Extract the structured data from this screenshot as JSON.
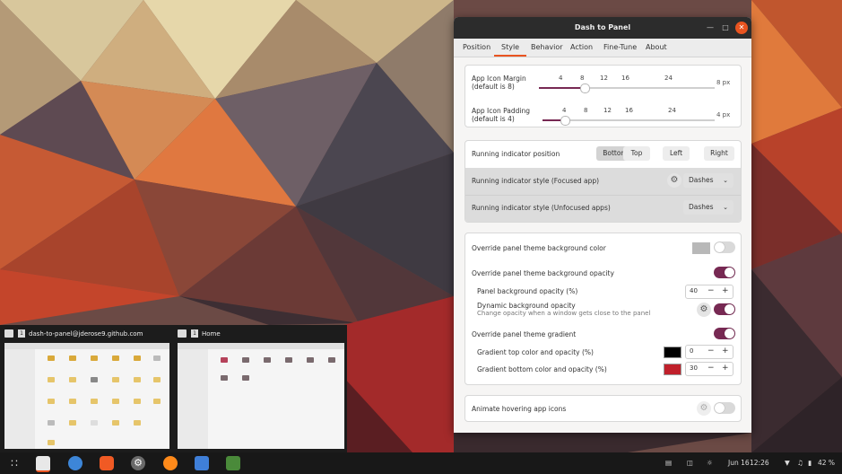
{
  "dialog": {
    "title": "Dash to Panel",
    "tabs": [
      "Position",
      "Style",
      "Behavior",
      "Action",
      "Fine-Tune",
      "About"
    ],
    "active_tab": "Style",
    "icon_margin": {
      "label_line1": "App Icon Margin",
      "label_line2": "(default is 8)",
      "ticks": [
        "4",
        "8",
        "12",
        "16",
        "24"
      ],
      "value_label": "8 px",
      "value": 8
    },
    "icon_padding": {
      "label_line1": "App Icon Padding",
      "label_line2": "(default is 4)",
      "ticks": [
        "4",
        "8",
        "12",
        "16",
        "24"
      ],
      "value_label": "4 px",
      "value": 4
    },
    "running_position": {
      "label": "Running indicator position",
      "options": [
        "Bottom",
        "Top",
        "Left",
        "Right"
      ],
      "selected": "Bottom"
    },
    "running_focused": {
      "label": "Running indicator style (Focused app)",
      "value": "Dashes"
    },
    "running_unfocused": {
      "label": "Running indicator style (Unfocused apps)",
      "value": "Dashes"
    },
    "override_bg_color": {
      "label": "Override panel theme background color",
      "on": false,
      "swatch": "#b8b8b8"
    },
    "override_bg_opacity": {
      "label": "Override panel theme background opacity",
      "on": true
    },
    "panel_bg_opacity": {
      "label": "Panel background opacity (%)",
      "value": "40"
    },
    "dynamic_bg": {
      "label": "Dynamic background opacity",
      "sub": "Change opacity when a window gets close to the panel",
      "on": true
    },
    "override_gradient": {
      "label": "Override panel theme gradient",
      "on": true
    },
    "gradient_top": {
      "label": "Gradient top color and opacity (%)",
      "value": "0",
      "color": "#000000"
    },
    "gradient_bottom": {
      "label": "Gradient bottom color and opacity (%)",
      "value": "30",
      "color": "#c0202b"
    },
    "animate": {
      "label": "Animate hovering app icons",
      "on": false
    }
  },
  "previews": [
    {
      "num": "1",
      "title": "dash-to-panel@jderose9.github.com"
    },
    {
      "num": "1",
      "title": "Home"
    }
  ],
  "taskbar": {
    "icons": [
      "apps-grid-icon",
      "files-icon",
      "browser-icon",
      "brave-icon",
      "settings-icon",
      "firefox-icon",
      "text-editor-icon",
      "extension-manager-icon"
    ],
    "date": "Jun 16",
    "time": "12:26",
    "battery": "42 %"
  },
  "colors": {
    "accent": "#e95420",
    "toggle_on": "#772953"
  }
}
